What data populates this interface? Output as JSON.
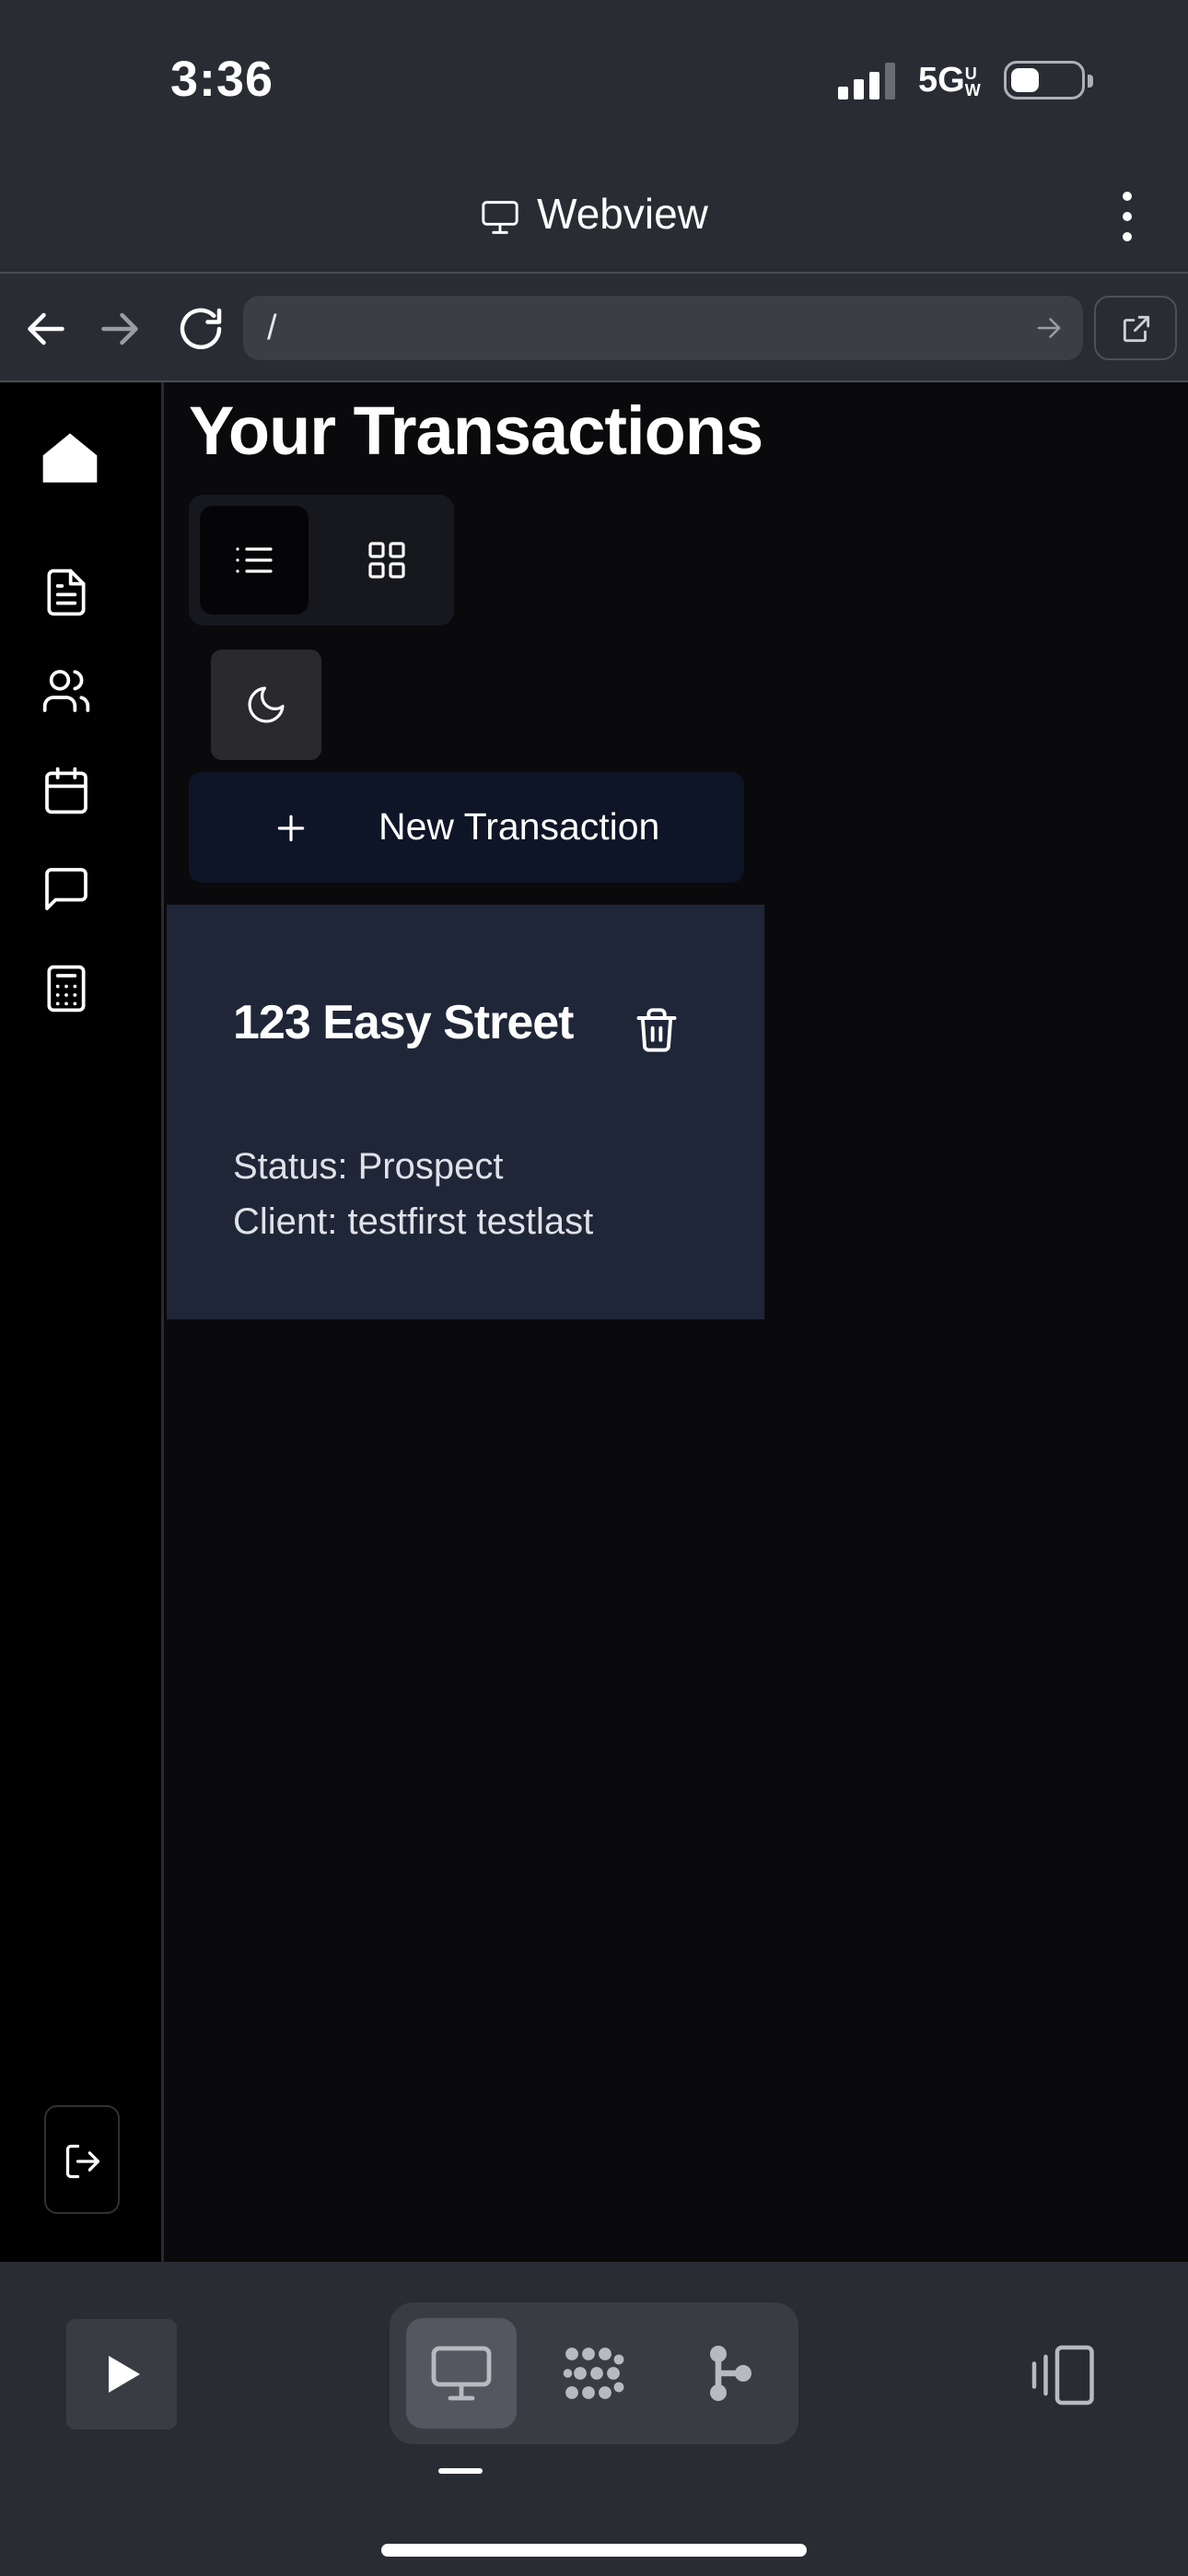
{
  "status_bar": {
    "time": "3:36",
    "network": "5G",
    "network_badge": "UW"
  },
  "webview": {
    "title": "Webview"
  },
  "browser": {
    "url": "/"
  },
  "sidebar": {
    "items": [
      {
        "icon": "home-icon"
      },
      {
        "icon": "document-icon"
      },
      {
        "icon": "users-icon"
      },
      {
        "icon": "calendar-icon"
      },
      {
        "icon": "message-icon"
      },
      {
        "icon": "calculator-icon"
      }
    ],
    "logout_icon": "logout-icon"
  },
  "main": {
    "title": "Your Transactions",
    "view_toggle": {
      "selected": "list"
    },
    "new_transaction_label": "New Transaction",
    "transactions": [
      {
        "address": "123 Easy Street",
        "status": "Status: Prospect",
        "client": "Client: testfirst testlast"
      }
    ]
  },
  "colors": {
    "chrome_bg": "#2a2c34",
    "app_bg": "#0a0a0c",
    "card_bg": "#1f2637",
    "new_btn_bg": "#0e1526"
  }
}
